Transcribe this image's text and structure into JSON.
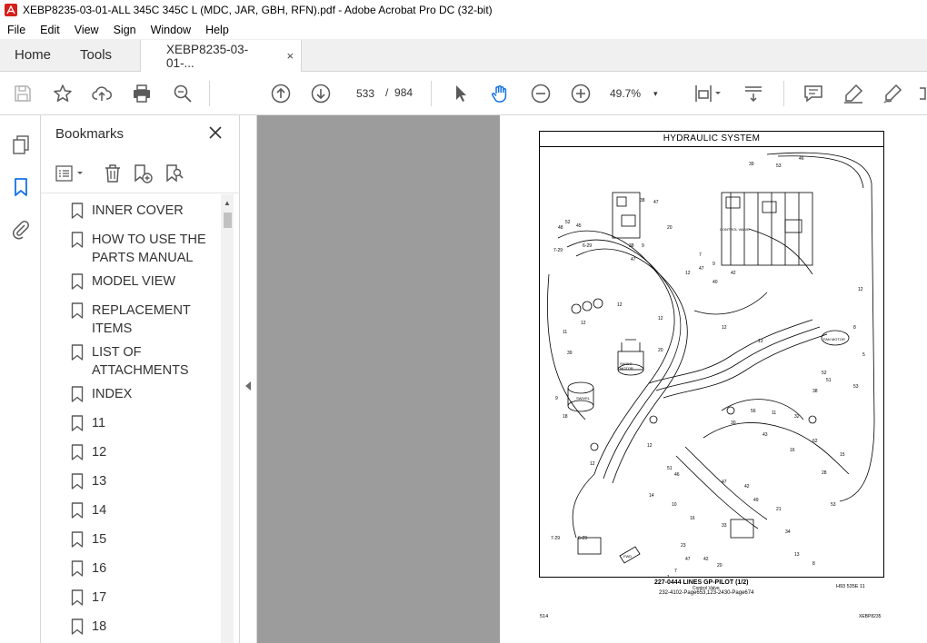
{
  "window": {
    "title": "XEBP8235-03-01-ALL 345C 345C L (MDC, JAR, GBH, RFN).pdf - Adobe Acrobat Pro DC (32-bit)"
  },
  "menu": [
    "File",
    "Edit",
    "View",
    "Sign",
    "Window",
    "Help"
  ],
  "tabs": {
    "home": "Home",
    "tools": "Tools",
    "document": "XEBP8235-03-01-...",
    "close": "×"
  },
  "toolbar": {
    "current_page": "533",
    "page_separator": "/",
    "total_pages": "984",
    "zoom": "49.7%",
    "zoom_caret": "▾"
  },
  "bookmarks": {
    "title": "Bookmarks",
    "items": [
      {
        "label_lines": [
          "INNER COVER"
        ]
      },
      {
        "label_lines": [
          "HOW TO USE THE",
          "PARTS MANUAL"
        ]
      },
      {
        "label_lines": [
          "MODEL VIEW"
        ]
      },
      {
        "label_lines": [
          "REPLACEMENT",
          "ITEMS"
        ]
      },
      {
        "label_lines": [
          "LIST OF",
          "ATTACHMENTS"
        ]
      },
      {
        "label_lines": [
          "INDEX"
        ]
      },
      {
        "label_lines": [
          "11"
        ]
      },
      {
        "label_lines": [
          "12"
        ]
      },
      {
        "label_lines": [
          "13"
        ]
      },
      {
        "label_lines": [
          "14"
        ]
      },
      {
        "label_lines": [
          "15"
        ]
      },
      {
        "label_lines": [
          "16"
        ]
      },
      {
        "label_lines": [
          "17"
        ]
      },
      {
        "label_lines": [
          "18"
        ]
      }
    ]
  },
  "pdf_page": {
    "header": "HYDRAULIC  SYSTEM",
    "caption_main": "227-0444  LINES  GP-PILOT (1/2)",
    "caption_sub": "Control Valve",
    "caption_refs": "232-4102-Page653,123-2430-Page674",
    "figure_code": "H93 535E    11",
    "page_number": "514",
    "doc_code": "XEBP8235",
    "diagram_labels": {
      "control_valve": "CONTROL VALVE",
      "swing_motor": "SWING MOTOR (LH)",
      "swivel": "SWIVEL",
      "fan_motor": "FAN MOTOR",
      "fwd": "FWD"
    }
  },
  "colors": {
    "acrobat_red": "#d4211b",
    "doc_bg": "#9c9c9c",
    "panel_border": "#d6d6d6",
    "icon_gray": "#5a5a5a"
  }
}
